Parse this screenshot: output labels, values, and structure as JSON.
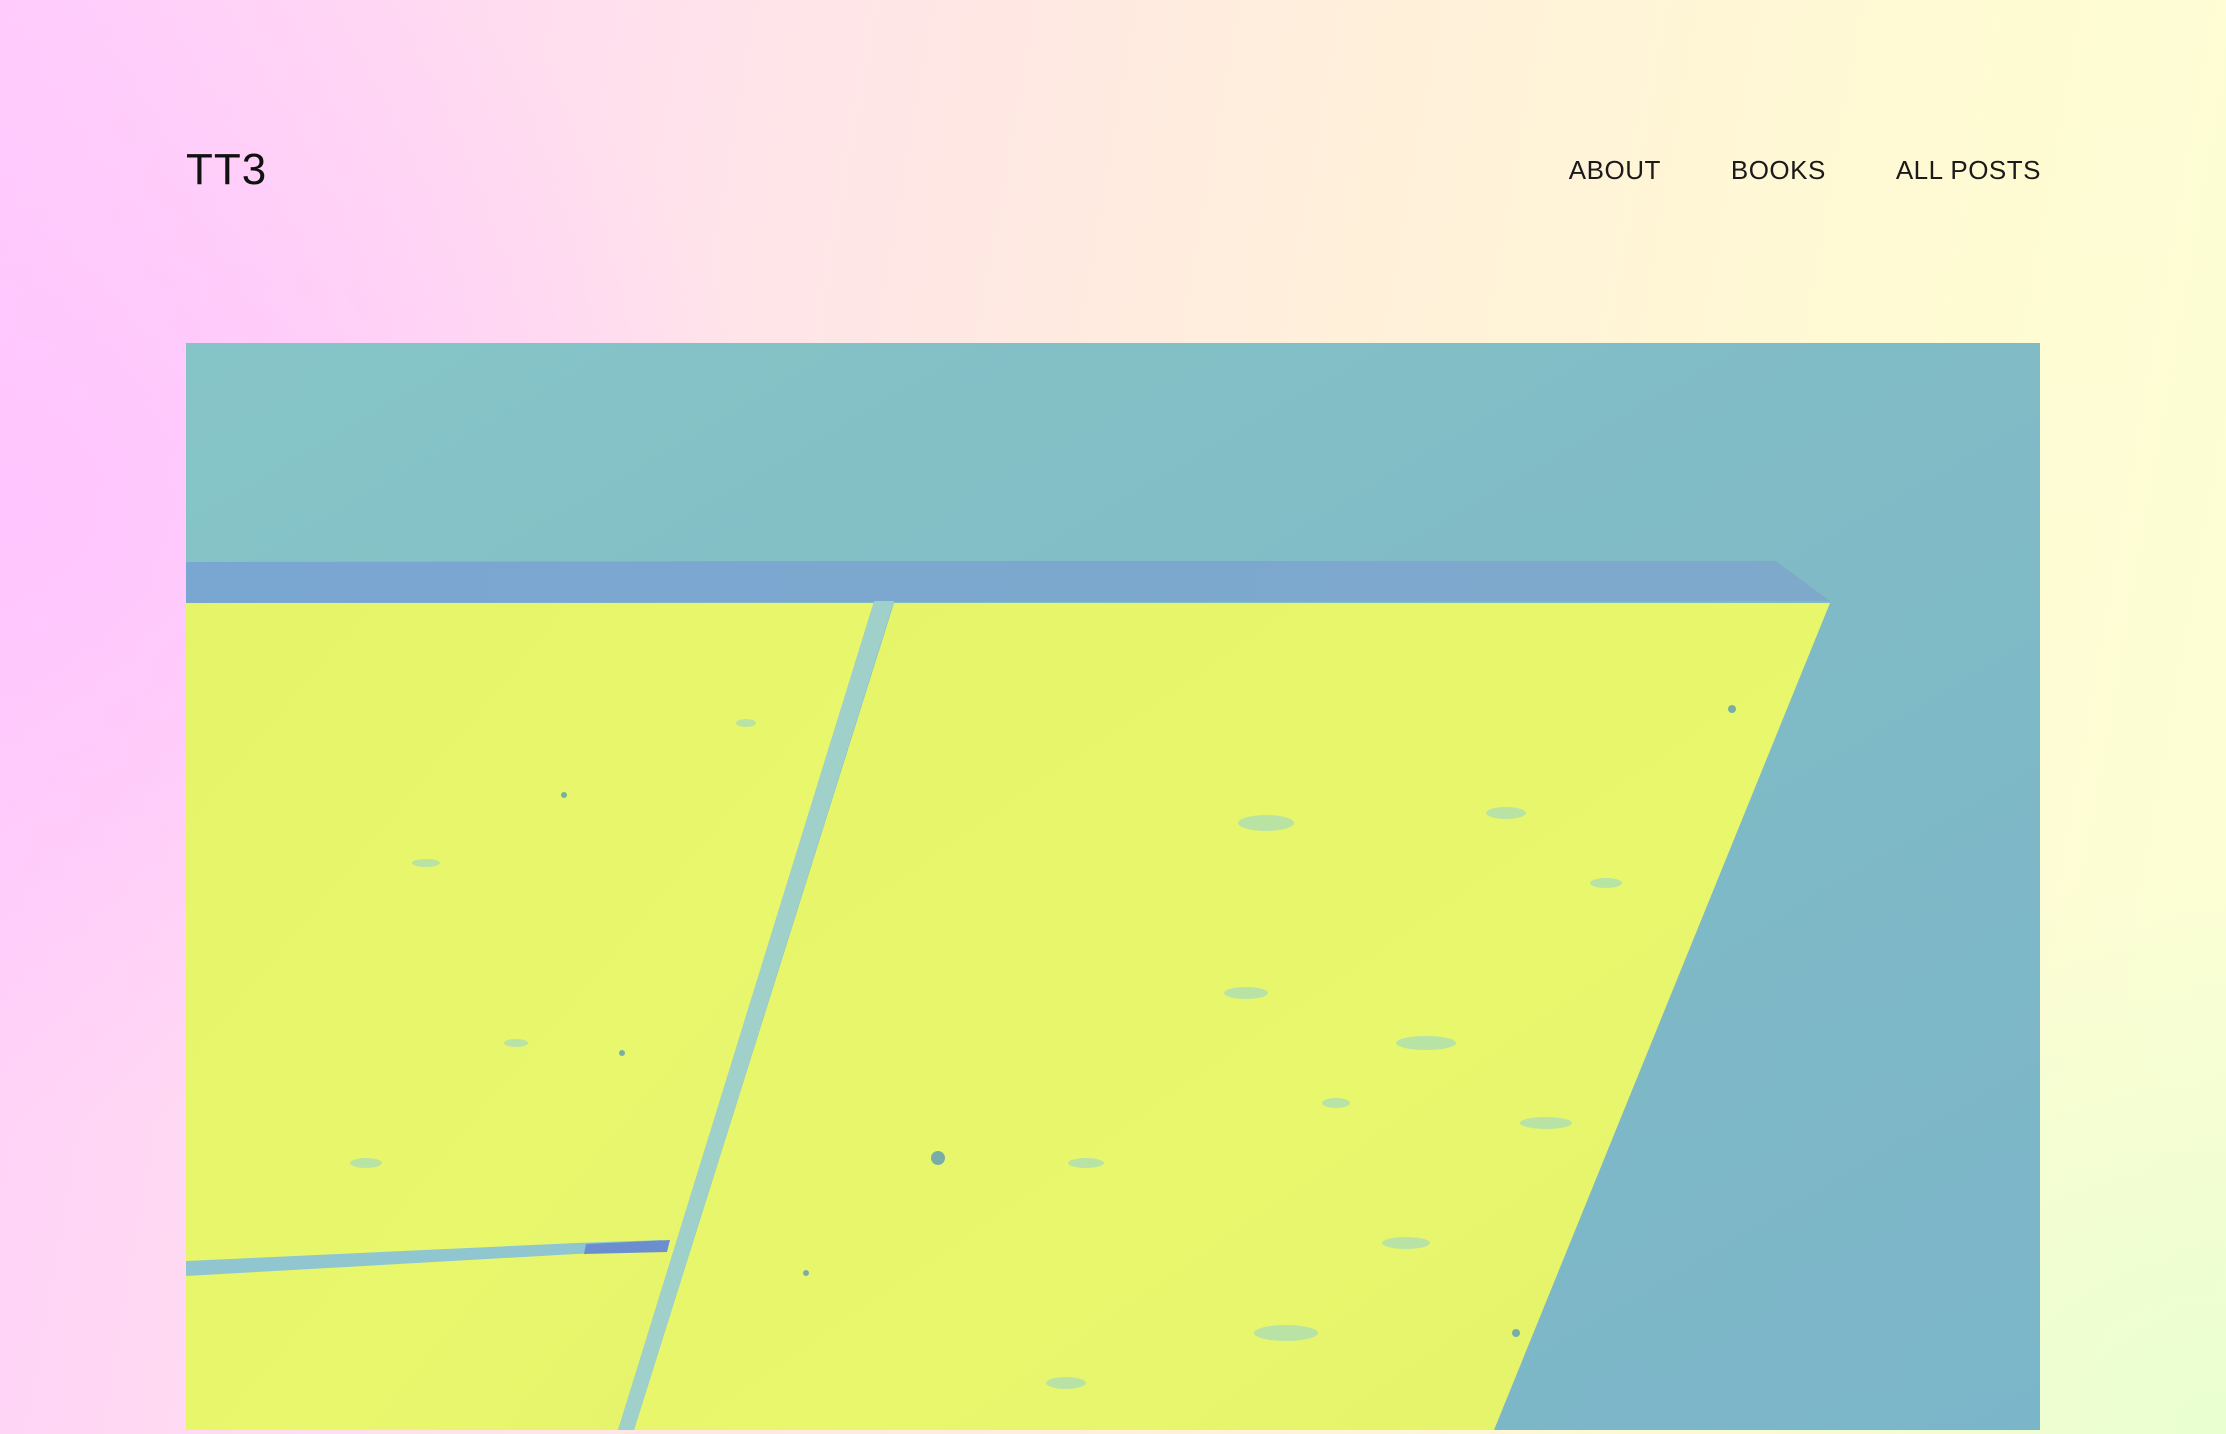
{
  "header": {
    "site_title": "TT3",
    "nav": {
      "about": "ABOUT",
      "books": "BOOKS",
      "all_posts": "ALL POSTS"
    }
  },
  "hero": {
    "image_subject": "abstract yellow concrete panels against blue sky",
    "colors": {
      "sky": "#7fb9c5",
      "panel": "#e8f56c",
      "edge": "#7ea4cf"
    }
  }
}
